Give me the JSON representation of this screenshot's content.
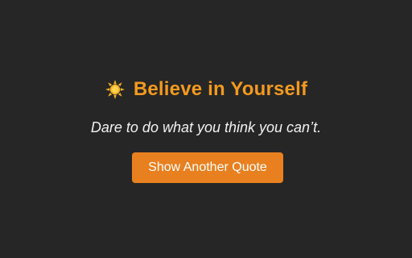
{
  "page": {
    "background": "#262626"
  },
  "header": {
    "icon": "sun-emoji-icon",
    "title": "Believe in Yourself",
    "title_color": "#f39a1f"
  },
  "quote": {
    "text": "Dare to do what you think you can’t."
  },
  "actions": {
    "primary_label": "Show Another Quote",
    "primary_color": "#e8801f"
  }
}
